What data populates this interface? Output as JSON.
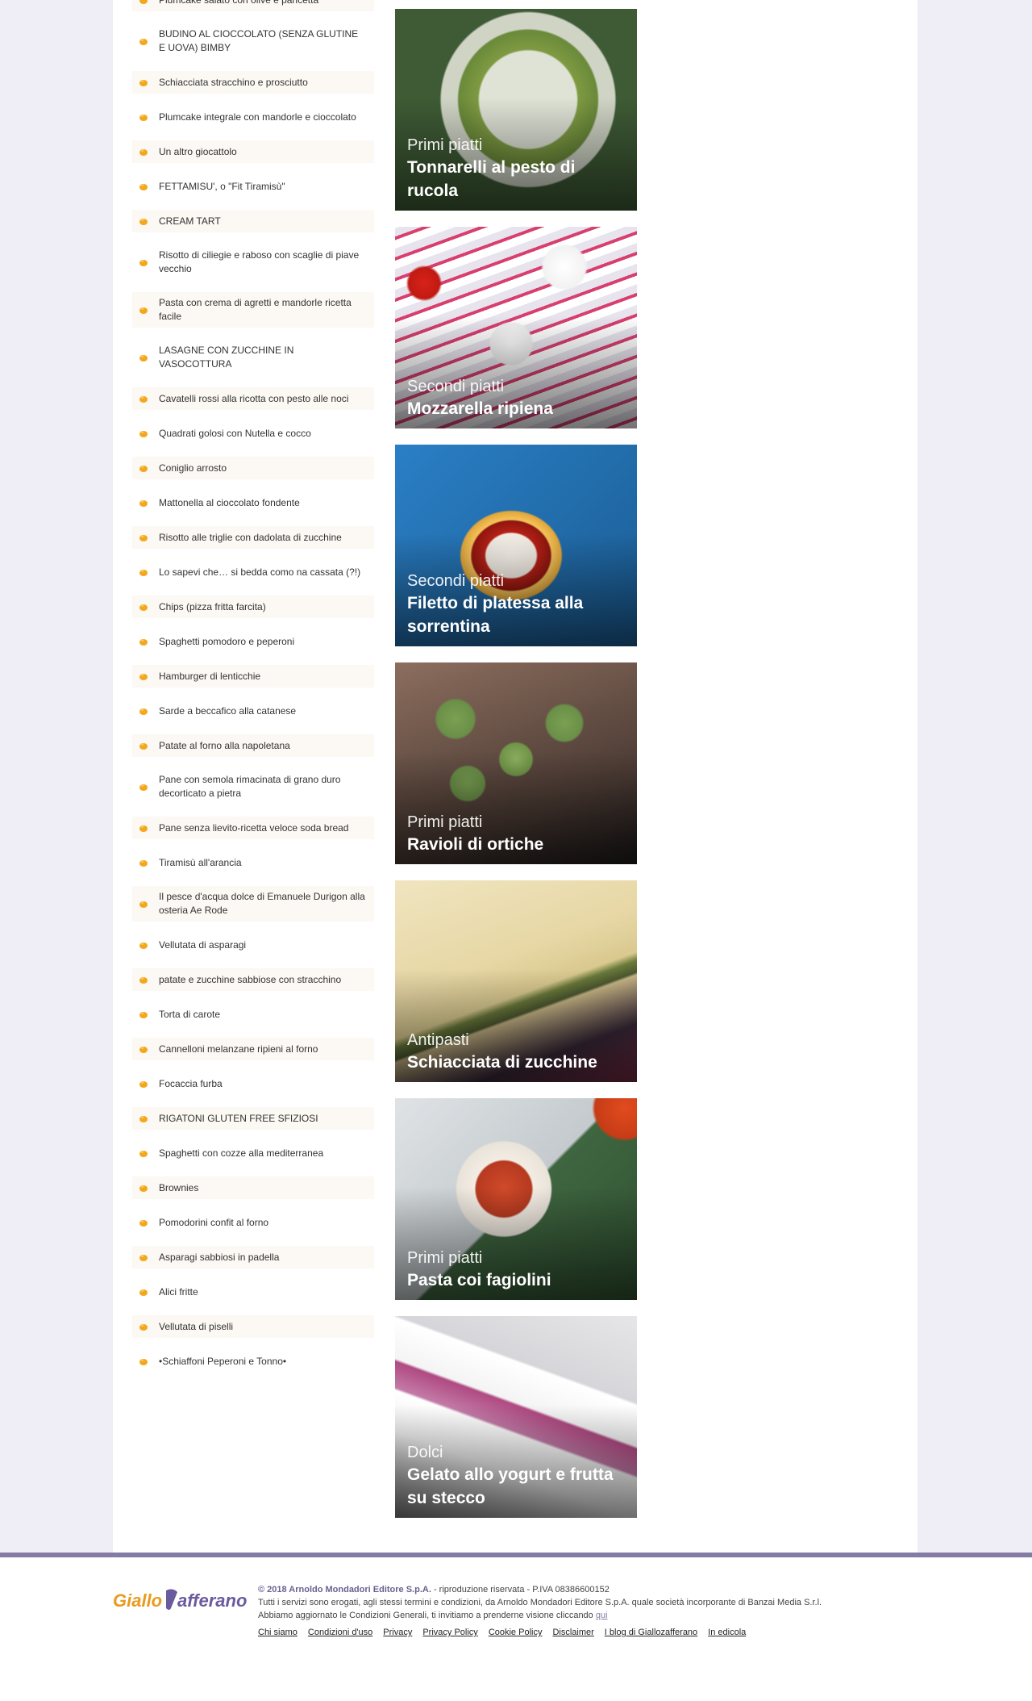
{
  "recipes": [
    "Plumcake salato con olive e pancetta",
    "BUDINO AL CIOCCOLATO (SENZA GLUTINE E UOVA) BIMBY",
    "Schiacciata stracchino e prosciutto",
    "Plumcake integrale con mandorle e cioccolato",
    "Un altro giocattolo",
    "FETTAMISU', o \"Fit Tiramisù\"",
    "CREAM TART",
    "Risotto di ciliegie e raboso con scaglie di piave vecchio",
    "Pasta con crema di agretti e mandorle ricetta facile",
    "LASAGNE CON ZUCCHINE IN VASOCOTTURA",
    "Cavatelli rossi alla ricotta con pesto alle noci",
    "Quadrati golosi con Nutella e cocco",
    "Coniglio arrosto",
    "Mattonella al cioccolato fondente",
    "Risotto alle triglie con dadolata di zucchine",
    "Lo sapevi che… si bedda como na cassata (?!)",
    "Chips (pizza fritta farcita)",
    "Spaghetti pomodoro e peperoni",
    "Hamburger di lenticchie",
    "Sarde a beccafico alla catanese",
    "Patate al forno alla napoletana",
    "Pane con semola rimacinata di grano duro decorticato a pietra",
    "Pane senza lievito-ricetta veloce soda bread",
    "Tiramisù all'arancia",
    "Il pesce d'acqua dolce di Emanuele Durigon alla osteria Ae Rode",
    "Vellutata di asparagi",
    "patate e zucchine sabbiose con stracchino",
    "Torta di carote",
    "Cannelloni melanzane ripieni al forno",
    "Focaccia furba",
    "RIGATONI GLUTEN FREE SFIZIOSI",
    "Spaghetti con cozze alla mediterranea",
    "Brownies",
    "Pomodorini confit al forno",
    "Asparagi sabbiosi in padella",
    "Alici fritte",
    "Vellutata di piselli",
    "•Schiaffoni Peperoni e Tonno•"
  ],
  "cards": [
    {
      "category": "Primi piatti",
      "title": "Tonnarelli al pesto di rucola"
    },
    {
      "category": "Secondi piatti",
      "title": "Mozzarella ripiena"
    },
    {
      "category": "Secondi piatti",
      "title": "Filetto di platessa alla sorrentina"
    },
    {
      "category": "Primi piatti",
      "title": "Ravioli di ortiche"
    },
    {
      "category": "Antipasti",
      "title": "Schiacciata di zucchine"
    },
    {
      "category": "Primi piatti",
      "title": "Pasta coi fagiolini"
    },
    {
      "category": "Dolci",
      "title": "Gelato allo yogurt e frutta su stecco"
    }
  ],
  "footer": {
    "logo_text": "GialloZafferano",
    "copyright": "© 2018 Arnoldo Mondadori Editore S.p.A.",
    "copyright_rest": " - riproduzione riservata - P.IVA 08386600152",
    "line2": "Tutti i servizi sono erogati, agli stessi termini e condizioni, da Arnoldo Mondadori Editore S.p.A. quale società incorporante di Banzai Media S.r.l.",
    "line3": "Abbiamo aggiornato le Condizioni Generali, ti invitiamo a prenderne visione cliccando ",
    "line3_link": "qui",
    "links": [
      "Chi siamo",
      "Condizioni d'uso",
      "Privacy",
      "Privacy Policy",
      "Cookie Policy",
      "Disclaimer",
      "I blog di Giallozafferano",
      "In edicola"
    ]
  },
  "colors": {
    "page_bg": "#efedf5",
    "alt_row": "#fcf8f3",
    "footer_bar": "#857ca6",
    "bullet": "#f2a81d",
    "logo_yellow": "#e89b1d",
    "logo_purple": "#6a5a9e"
  }
}
